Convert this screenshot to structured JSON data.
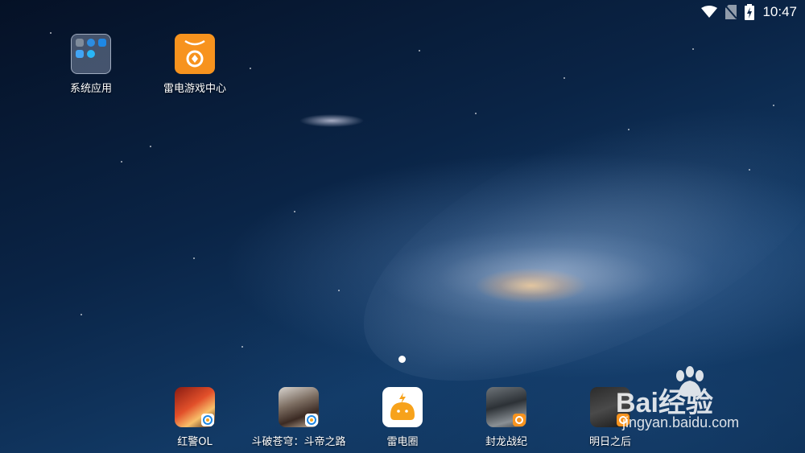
{
  "status_bar": {
    "time": "10:47",
    "icons": [
      "wifi-icon",
      "no-sim-icon",
      "battery-charging-icon"
    ]
  },
  "desktop": {
    "top_icons": [
      {
        "name": "系统应用",
        "icon": "folder-icon"
      },
      {
        "name": "雷电游戏中心",
        "icon": "game-center-icon"
      }
    ],
    "dock_apps": [
      {
        "name": "红警OL",
        "icon": "red-alert-app-icon"
      },
      {
        "name": "斗破苍穹：斗帝之路",
        "icon": "doupo-app-icon"
      },
      {
        "name": "雷电圈",
        "icon": "leidian-circle-app-icon"
      },
      {
        "name": "封龙战纪",
        "icon": "fenglong-app-icon"
      },
      {
        "name": "明日之后",
        "icon": "mingri-app-icon"
      }
    ],
    "page_indicator": {
      "current": 1,
      "total": 1
    }
  },
  "watermark": {
    "brand": "Bai经验",
    "url": "jingyan.baidu.com"
  },
  "colors": {
    "accent_orange": "#f7931e",
    "text": "#ffffff",
    "background": "#0a2446"
  }
}
